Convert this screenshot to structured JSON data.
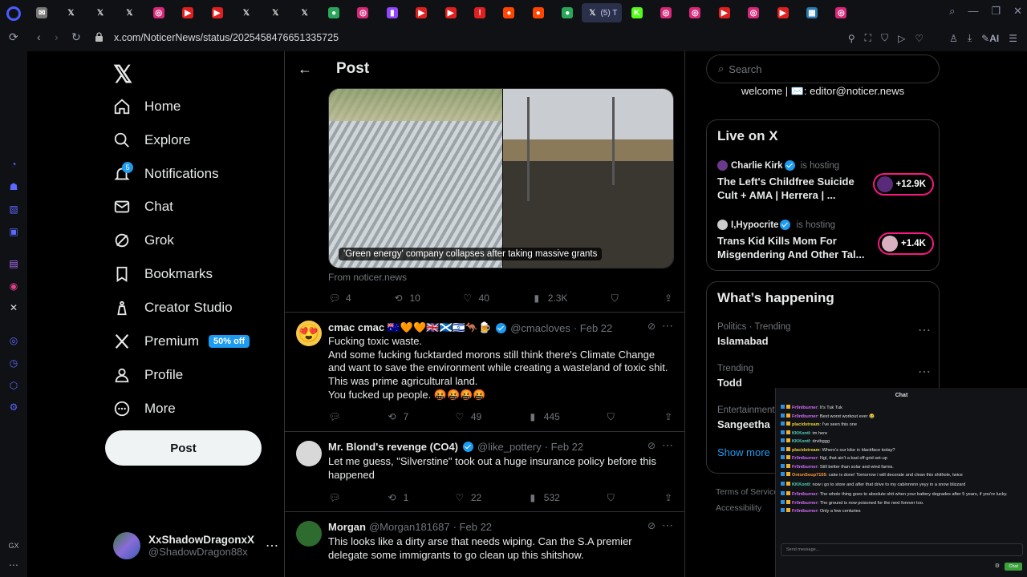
{
  "browser": {
    "active_tab_label": "(5) T",
    "url": "x.com/NoticerNews/status/2025458476651335725",
    "ai_label": "AI",
    "tab_favicons": [
      "mail-tab",
      "x-tab",
      "x-tab",
      "x-tab",
      "instagram-tab",
      "youtube-tab",
      "youtube-tab",
      "x-tab",
      "x-tab",
      "x-tab",
      "chrome-tab",
      "instagram-tab",
      "twitch-tab",
      "youtube-tab",
      "youtube-tab",
      "alert-tab",
      "reddit-tab",
      "reddit-tab",
      "chrome-tab",
      "x-active-tab",
      "kick-tab",
      "instagram-tab",
      "instagram-tab",
      "youtube-tab",
      "instagram-tab",
      "youtube-tab",
      "image-tab",
      "instagram-tab"
    ]
  },
  "nav": {
    "items": [
      {
        "label": "Home",
        "icon": "home-icon"
      },
      {
        "label": "Explore",
        "icon": "search-icon"
      },
      {
        "label": "Notifications",
        "icon": "bell-icon"
      },
      {
        "label": "Chat",
        "icon": "mail-icon"
      },
      {
        "label": "Grok",
        "icon": "grok-icon"
      },
      {
        "label": "Bookmarks",
        "icon": "bookmark-icon"
      },
      {
        "label": "Creator Studio",
        "icon": "creator-icon"
      },
      {
        "label": "Premium",
        "icon": "x-icon"
      },
      {
        "label": "Profile",
        "icon": "person-icon"
      },
      {
        "label": "More",
        "icon": "more-icon"
      }
    ],
    "notif_count": "5",
    "premium_badge": "50% off",
    "post_button": "Post"
  },
  "account": {
    "name": "XxShadowDragonxX",
    "handle": "@ShadowDragon88x"
  },
  "header": {
    "title": "Post"
  },
  "main_post": {
    "caption": "'Green energy' company collapses after taking massive grants",
    "source": "From noticer.news",
    "stats": {
      "replies": "4",
      "reposts": "10",
      "likes": "40",
      "views": "2.3K"
    }
  },
  "replies": [
    {
      "name": "cmac cmac 🇦🇺🧡🧡🇬🇧🏴󠁧󠁢󠁳󠁣󠁴󠁿🇮🇱🦘🍺",
      "handle": "@cmacloves",
      "date": "· Feb 22",
      "lines": [
        "Fucking toxic waste.",
        "And some fucking fucktarded morons still think there's Climate Change and want to save the environment while creating a wasteland of toxic shit.",
        "This was prime agricultural land.",
        "You fucked up people. 🤬🤬🤬🤬"
      ],
      "stats": {
        "replies": "",
        "reposts": "7",
        "likes": "49",
        "views": "445"
      }
    },
    {
      "name": "Mr. Blond's revenge (CO4)",
      "handle": "@like_pottery",
      "date": "· Feb 22",
      "lines": [
        "Let me guess, \"Silverstine\" took out a huge insurance policy before this happened"
      ],
      "stats": {
        "replies": "",
        "reposts": "1",
        "likes": "22",
        "views": "532"
      }
    },
    {
      "name": "Morgan",
      "handle": "@Morgan181687",
      "date": "· Feb 22",
      "lines": [
        "This looks like a dirty arse that needs wiping. Can the S.A premier delegate some immigrants to go clean up this shitshow."
      ]
    }
  ],
  "right": {
    "search_placeholder": "Search",
    "welcome": "welcome | ✉️: editor@noticer.news",
    "live_title": "Live on X",
    "live": [
      {
        "host": "Charlie Kirk",
        "hosting": "is hosting",
        "title": "The Left's Childfree Suicide Cult + AMA | Herrera | ...",
        "count": "+12.9K"
      },
      {
        "host": "I,Hypocrite",
        "hosting": "is hosting",
        "title": "Trans Kid Kills Mom For Misgendering And Other Tal...",
        "count": "+1.4K"
      }
    ],
    "happening_title": "What’s happening",
    "trends": [
      {
        "category": "Politics · Trending",
        "name": "Islamabad"
      },
      {
        "category": "Trending",
        "name": "Todd"
      },
      {
        "category": "Entertainment",
        "name": "Sangeetha"
      }
    ],
    "show_more": "Show more",
    "footer1": "Terms of Service",
    "footer2": "Accessibility"
  },
  "chat": {
    "title": "Chat",
    "messages": [
      {
        "user": "Fr0ntburner",
        "text": "It's Tuk Tuk",
        "color": "#d96bff"
      },
      {
        "user": "Fr0ntburner",
        "text": "Best worst workout ever 😂",
        "color": "#d96bff"
      },
      {
        "user": "placidstream",
        "text": "I've seen this one",
        "color": "#f0d23a"
      },
      {
        "user": "KKKontl",
        "text": "im here",
        "color": "#4fd6c0"
      },
      {
        "user": "KKKontl",
        "text": "drvibggg",
        "color": "#4fd6c0"
      },
      {
        "user": "placidstream",
        "text": "Where's our kike in blackface today?",
        "color": "#f0d23a"
      },
      {
        "user": "Fr0ntburner",
        "text": "Ngl, that ain't a bad off-grid set-up",
        "color": "#d96bff"
      },
      {
        "user": "Fr0ntburner",
        "text": "Still better than solar and wind farms.",
        "color": "#d96bff"
      },
      {
        "user": "OnionSoup7155",
        "text": "cake is done! Tomorrow i will decorate and clean this shithole, twice",
        "color": "#ff9a3a"
      },
      {
        "user": "KKKontl",
        "text": "now i go to store and after that drive to my cabinnnnn yeyy in a snow blizzard",
        "color": "#4fd6c0"
      },
      {
        "user": "Fr0ntburner",
        "text": "The whole thing goes to absolute shit when your battery degrades after 5 years, if you're lucky.",
        "color": "#d96bff"
      },
      {
        "user": "Fr0ntburner",
        "text": "The ground is now poisoned for the next forever too.",
        "color": "#d96bff"
      },
      {
        "user": "Fr0ntburner",
        "text": "Only a few centuries",
        "color": "#d96bff"
      }
    ],
    "input_placeholder": "Send message...",
    "send_label": "Chat"
  }
}
